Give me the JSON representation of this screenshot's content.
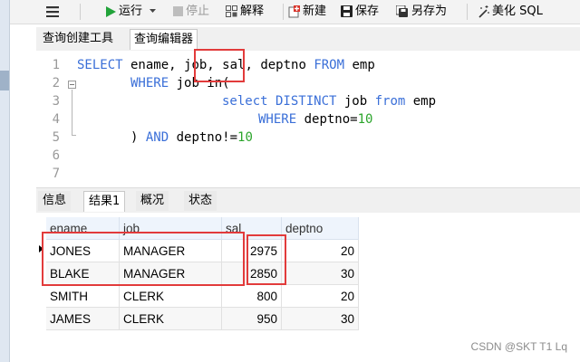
{
  "toolbar": {
    "menu_icon": "hamburger-menu-icon",
    "run_label": "运行",
    "stop_label": "停止",
    "explain_label": "解释",
    "new_label": "新建",
    "save_label": "保存",
    "save_as_label": "另存为",
    "beautify_label": "美化 SQL",
    "colors": {
      "run": "#22a33a",
      "new": "#d8342b",
      "save": "#222222"
    }
  },
  "query_tabs": [
    {
      "label": "查询创建工具",
      "active": false
    },
    {
      "label": "查询编辑器",
      "active": true
    }
  ],
  "editor": {
    "lines": [
      {
        "no": "1"
      },
      {
        "no": "2"
      },
      {
        "no": "3"
      },
      {
        "no": "4"
      },
      {
        "no": "5"
      },
      {
        "no": "6"
      },
      {
        "no": "7"
      }
    ],
    "tokens": {
      "l1_select": "SELECT",
      "l1_a": " ename,",
      "l1_job": " job,",
      "l1_b": " sal, deptno ",
      "l1_from": "FROM",
      "l1_c": " emp",
      "l2_where": "WHERE",
      "l2_a": " job in(",
      "l3_select": "select",
      "l3_distinct": " DISTINCT",
      "l3_a": " job ",
      "l3_from": "from",
      "l3_b": " emp",
      "l4_where": "WHERE",
      "l4_a": " deptno=",
      "l4_num": "10",
      "l5_a": ") ",
      "l5_and": "AND",
      "l5_b": " deptno!=",
      "l5_num": "10"
    },
    "colors": {
      "keyword": "#3a6fd8",
      "number": "#2ca52c"
    }
  },
  "result_tabs": [
    {
      "label": "信息",
      "active": false
    },
    {
      "label": "结果1",
      "active": true
    },
    {
      "label": "概况",
      "active": false
    },
    {
      "label": "状态",
      "active": false
    }
  ],
  "grid": {
    "columns": [
      "ename",
      "job",
      "sal",
      "deptno"
    ],
    "rows": [
      [
        "JONES",
        "MANAGER",
        "2975",
        "20"
      ],
      [
        "BLAKE",
        "MANAGER",
        "2850",
        "30"
      ],
      [
        "SMITH",
        "CLERK",
        "800",
        "20"
      ],
      [
        "JAMES",
        "CLERK",
        "950",
        "30"
      ]
    ],
    "current_row": 0
  },
  "highlight_color": "#e23b3b",
  "watermark": "CSDN @SKT T1 Lq"
}
